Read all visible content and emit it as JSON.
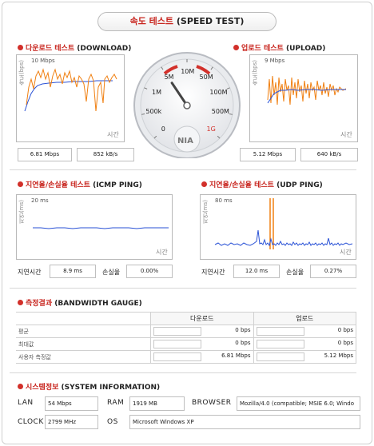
{
  "header": {
    "title_accent": "속도 테스트",
    "title_rest": "(SPEED TEST)"
  },
  "download": {
    "title_k": "다운로드 테스트",
    "title_e": "(DOWNLOAD)",
    "ylabel": "속도(bps)",
    "ymax": "10 Mbps",
    "xlabel": "시간",
    "speed": "6.81 Mbps",
    "rate": "852 kB/s"
  },
  "upload": {
    "title_k": "업로드 테스트",
    "title_e": "(UPLOAD)",
    "ylabel": "속도(bps)",
    "ymax": "9 Mbps",
    "xlabel": "시간",
    "speed": "5.12 Mbps",
    "rate": "640 kB/s"
  },
  "gauge": {
    "labels": [
      "0",
      "500k",
      "1M",
      "5M",
      "10M",
      "50M",
      "100M",
      "500M",
      "1G"
    ],
    "logo": "NIA",
    "needle_value": "5M",
    "colors": {
      "red": "#d2302a",
      "orange": "#f07f10",
      "blue": "#2a52d6"
    }
  },
  "icmp": {
    "title_k": "지연율/손실율 테스트",
    "title_e": "(ICMP PING)",
    "ylabel": "지연(ms)",
    "ymax": "20 ms",
    "xlabel": "시간",
    "delay_label": "지연시간",
    "delay": "8.9 ms",
    "loss_label": "손실율",
    "loss": "0.00%"
  },
  "udp": {
    "title_k": "지연율/손실율 테스트",
    "title_e": "(UDP PING)",
    "ylabel": "지연(ms)",
    "ymax": "80 ms",
    "xlabel": "시간",
    "delay_label": "지연시간",
    "delay": "12.0 ms",
    "loss_label": "손실율",
    "loss": "0.27%"
  },
  "bandwidth": {
    "title_k": "측정결과",
    "title_e": "(BANDWIDTH GAUGE)",
    "col_down": "다운로드",
    "col_up": "업로드",
    "rows": [
      {
        "label": "평균",
        "down": "0 bps",
        "up": "0 bps"
      },
      {
        "label": "최대값",
        "down": "0 bps",
        "up": "0 bps"
      },
      {
        "label": "사용자 측정값",
        "down": "6.81 Mbps",
        "up": "5.12 Mbps"
      }
    ]
  },
  "system": {
    "title_k": "시스템정보",
    "title_e": "(SYSTEM INFORMATION)",
    "lan_label": "LAN",
    "lan": "54 Mbps",
    "ram_label": "RAM",
    "ram": "1919 MB",
    "browser_label": "BROWSER",
    "browser": "Mozilla/4.0 (compatible; MSIE 6.0; Windo",
    "clock_label": "CLOCK",
    "clock": "2799 MHz",
    "os_label": "OS",
    "os": "Microsoft Windows XP"
  }
}
